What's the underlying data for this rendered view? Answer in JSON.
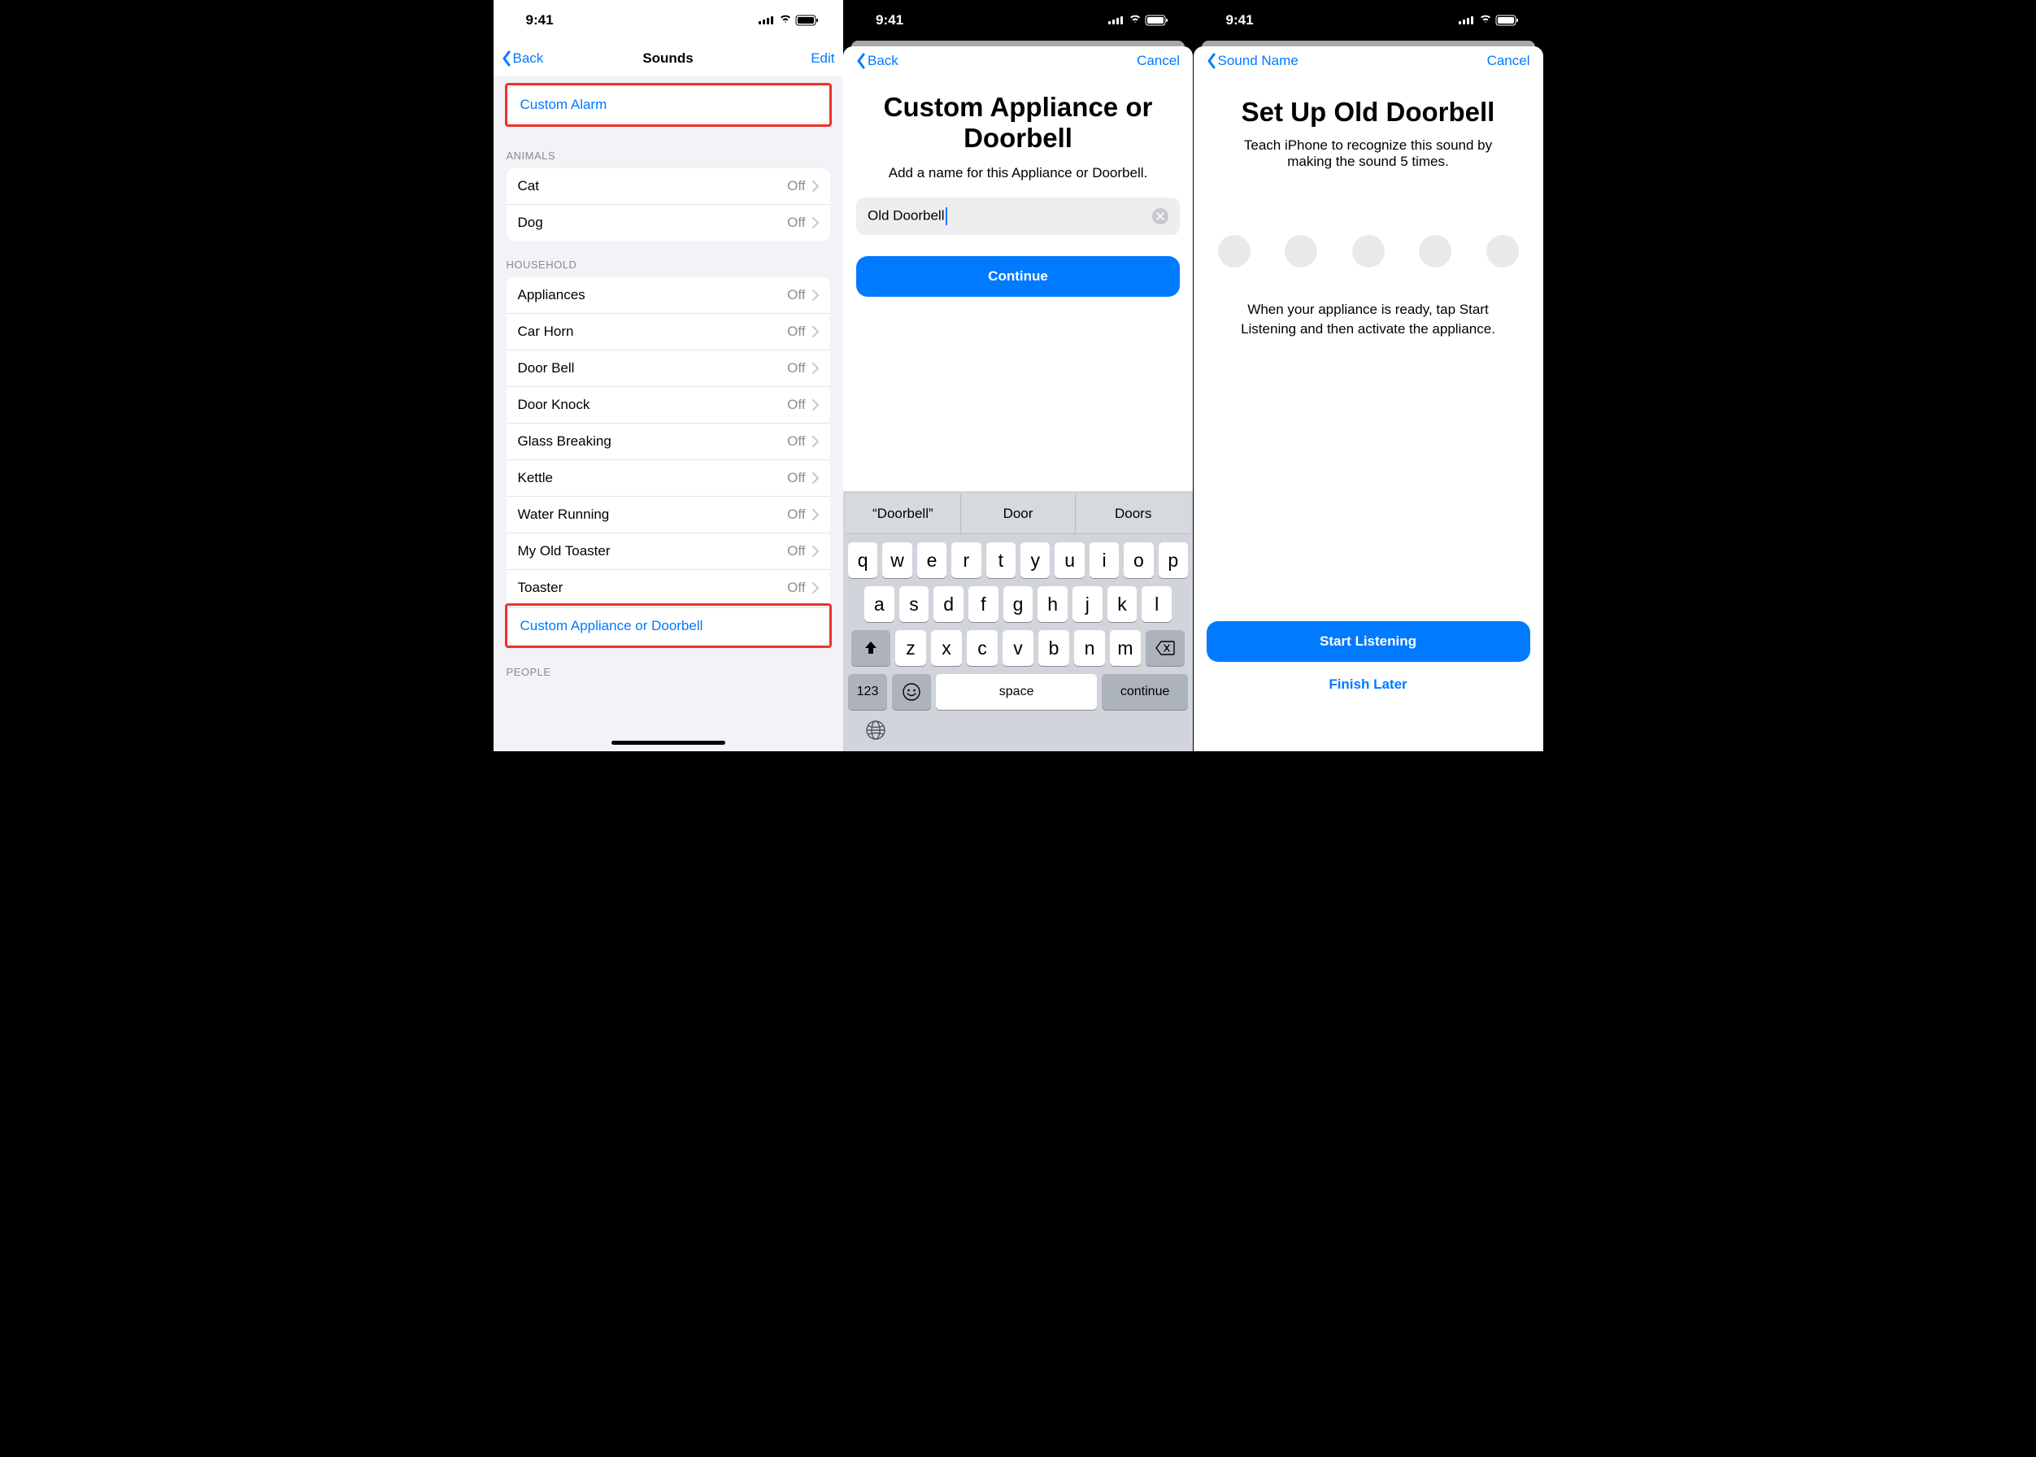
{
  "status": {
    "time": "9:41"
  },
  "screen1": {
    "back": "Back",
    "title": "Sounds",
    "edit": "Edit",
    "custom_alarm": "Custom Alarm",
    "sections": {
      "animals_header": "ANIMALS",
      "animals": [
        {
          "label": "Cat",
          "value": "Off"
        },
        {
          "label": "Dog",
          "value": "Off"
        }
      ],
      "household_header": "HOUSEHOLD",
      "household": [
        {
          "label": "Appliances",
          "value": "Off"
        },
        {
          "label": "Car Horn",
          "value": "Off"
        },
        {
          "label": "Door Bell",
          "value": "Off"
        },
        {
          "label": "Door Knock",
          "value": "Off"
        },
        {
          "label": "Glass Breaking",
          "value": "Off"
        },
        {
          "label": "Kettle",
          "value": "Off"
        },
        {
          "label": "Water Running",
          "value": "Off"
        },
        {
          "label": "My Old Toaster",
          "value": "Off"
        },
        {
          "label": "Toaster",
          "value": "Off"
        }
      ],
      "custom_appliance": "Custom Appliance or Doorbell",
      "people_header": "PEOPLE"
    }
  },
  "screen2": {
    "back": "Back",
    "cancel": "Cancel",
    "title": "Custom Appliance or Doorbell",
    "subtitle": "Add a name for this Appliance or Doorbell.",
    "input_value": "Old Doorbell",
    "continue": "Continue",
    "suggestions": [
      "“Doorbell”",
      "Door",
      "Doors"
    ],
    "kb_rows": {
      "r1": [
        "q",
        "w",
        "e",
        "r",
        "t",
        "y",
        "u",
        "i",
        "o",
        "p"
      ],
      "r2": [
        "a",
        "s",
        "d",
        "f",
        "g",
        "h",
        "j",
        "k",
        "l"
      ],
      "r3": [
        "z",
        "x",
        "c",
        "v",
        "b",
        "n",
        "m"
      ]
    },
    "kb_num": "123",
    "kb_space": "space",
    "kb_continue": "continue"
  },
  "screen3": {
    "back": "Sound Name",
    "cancel": "Cancel",
    "title": "Set Up Old Doorbell",
    "subtitle": "Teach iPhone to recognize this sound by making the sound 5 times.",
    "instruction": "When your appliance is ready, tap Start Listening and then activate the appliance.",
    "start": "Start Listening",
    "finish": "Finish Later"
  }
}
